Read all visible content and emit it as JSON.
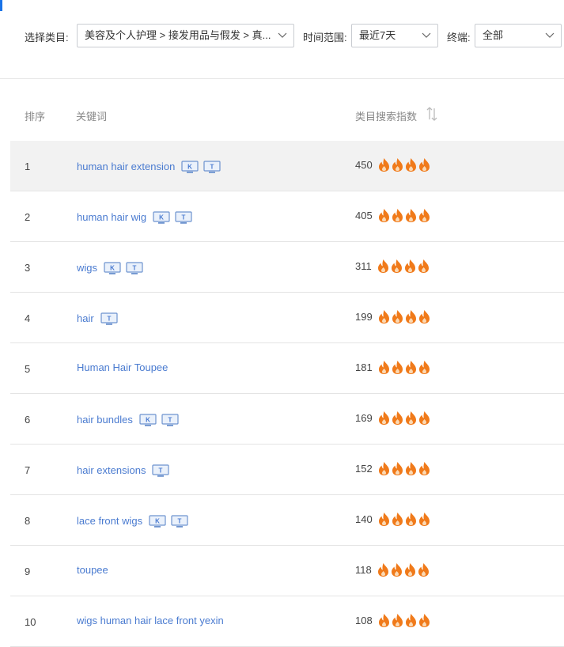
{
  "filters": {
    "category_label": "选择类目:",
    "category_value": "美容及个人护理 > 接发用品与假发 > 真...",
    "time_label": "时间范围:",
    "time_value": "最近7天",
    "device_label": "终端:",
    "device_value": "全部"
  },
  "table": {
    "headers": {
      "rank": "排序",
      "keyword": "关键词",
      "index": "类目搜索指数"
    },
    "rows": [
      {
        "rank": "1",
        "keyword": "human hair extension",
        "badges": [
          "K",
          "T"
        ],
        "score": "450",
        "flames": 4
      },
      {
        "rank": "2",
        "keyword": "human hair wig",
        "badges": [
          "K",
          "T"
        ],
        "score": "405",
        "flames": 4
      },
      {
        "rank": "3",
        "keyword": "wigs",
        "badges": [
          "K",
          "T"
        ],
        "score": "311",
        "flames": 4
      },
      {
        "rank": "4",
        "keyword": "hair",
        "badges": [
          "T"
        ],
        "score": "199",
        "flames": 4
      },
      {
        "rank": "5",
        "keyword": "Human Hair Toupee",
        "badges": [],
        "score": "181",
        "flames": 4
      },
      {
        "rank": "6",
        "keyword": "hair bundles",
        "badges": [
          "K",
          "T"
        ],
        "score": "169",
        "flames": 4
      },
      {
        "rank": "7",
        "keyword": "hair extensions",
        "badges": [
          "T"
        ],
        "score": "152",
        "flames": 4
      },
      {
        "rank": "8",
        "keyword": "lace front wigs",
        "badges": [
          "K",
          "T"
        ],
        "score": "140",
        "flames": 4
      },
      {
        "rank": "9",
        "keyword": "toupee",
        "badges": [],
        "score": "118",
        "flames": 4
      },
      {
        "rank": "10",
        "keyword": "wigs human hair lace front yexin",
        "badges": [],
        "score": "108",
        "flames": 4
      }
    ]
  },
  "colors": {
    "link": "#4a7bd0",
    "flame": "#f07a1a",
    "highlight_row": "#f2f2f2"
  },
  "icons": {
    "badge": "monitor-icon",
    "flame": "flame-icon",
    "sort": "sort-icon",
    "select_caret": "chevron-down-icon"
  }
}
